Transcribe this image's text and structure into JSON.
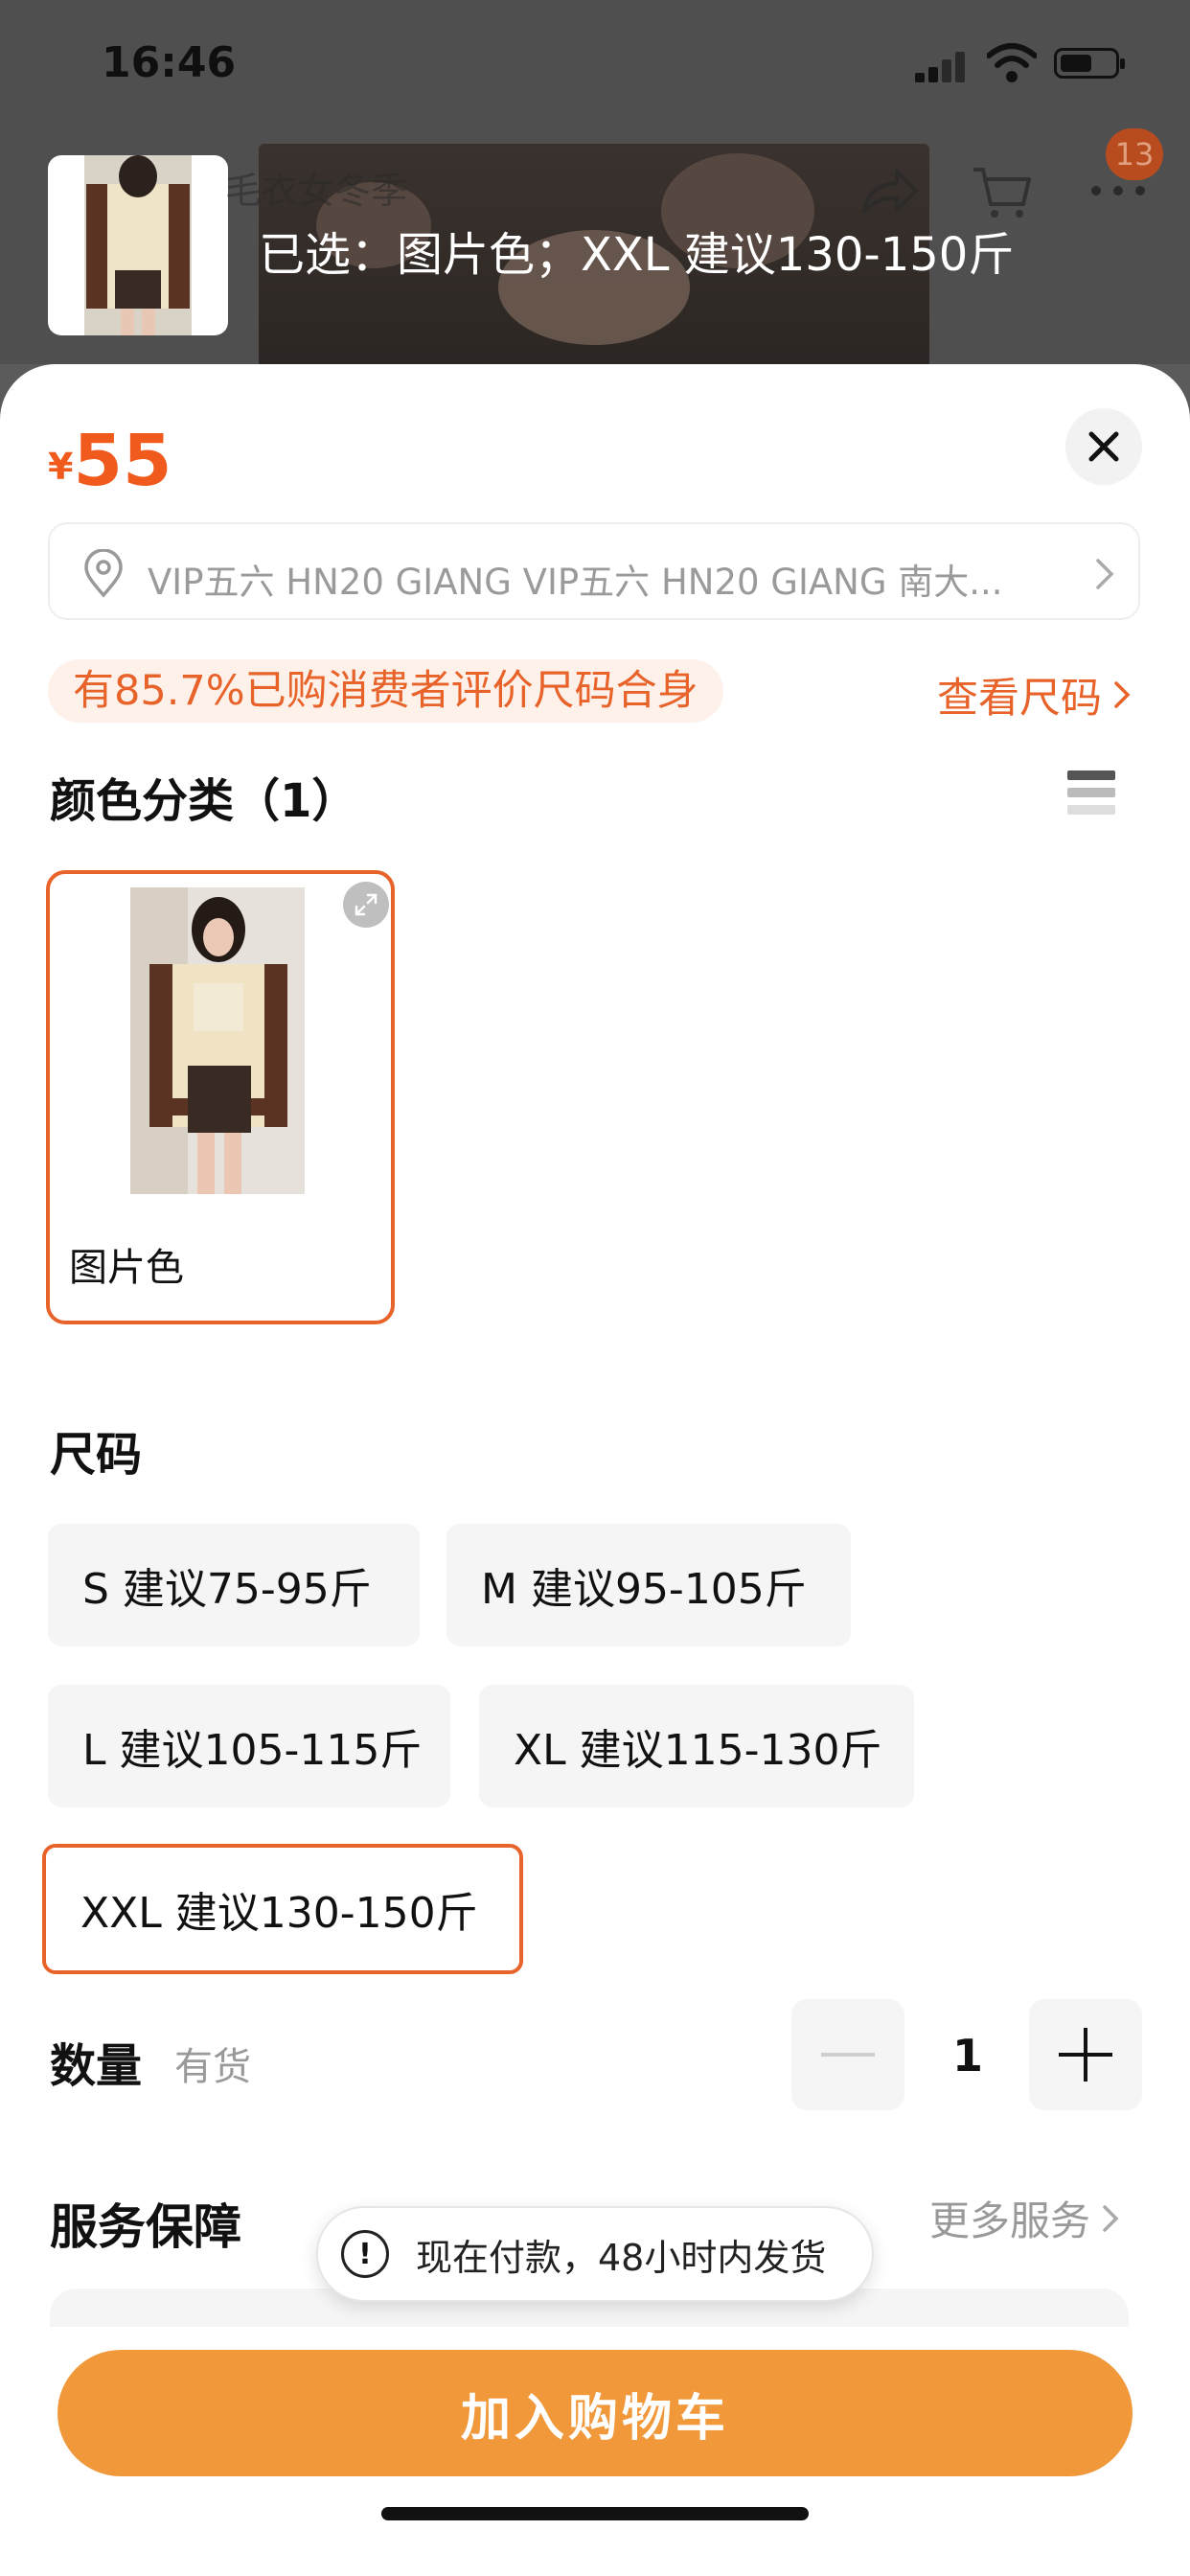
{
  "status_bar": {
    "time": "16:46"
  },
  "product_header": {
    "title_partial": "毛衣女冬季",
    "selected_text": "已选：图片色；XXL 建议130-150斤",
    "cart_badge": "13"
  },
  "sheet": {
    "price": {
      "currency": "¥",
      "value": "55",
      "color": "#f05a1c"
    },
    "address": "VIP五六 HN20 GIANG VIP五六 HN20 GIANG 南大...",
    "fit_note": "有85.7%已购消费者评价尺码合身",
    "size_chart_link": "查看尺码",
    "color_section": {
      "title": "颜色分类（1）",
      "options": [
        {
          "label": "图片色",
          "selected": true
        }
      ]
    },
    "size_section": {
      "title": "尺码",
      "options": [
        {
          "label": "S 建议75-95斤",
          "selected": false
        },
        {
          "label": "M 建议95-105斤",
          "selected": false
        },
        {
          "label": "L 建议105-115斤",
          "selected": false
        },
        {
          "label": "XL 建议115-130斤",
          "selected": false
        },
        {
          "label": "XXL 建议130-150斤",
          "selected": true
        }
      ]
    },
    "quantity": {
      "label": "数量",
      "stock": "有货",
      "value": "1"
    },
    "service": {
      "label": "服务保障",
      "more": "更多服务"
    },
    "toast": "现在付款，48小时内发货",
    "add_to_cart": "加入购物车"
  },
  "colors": {
    "accent": "#e8632a",
    "button": "#f0983a"
  }
}
